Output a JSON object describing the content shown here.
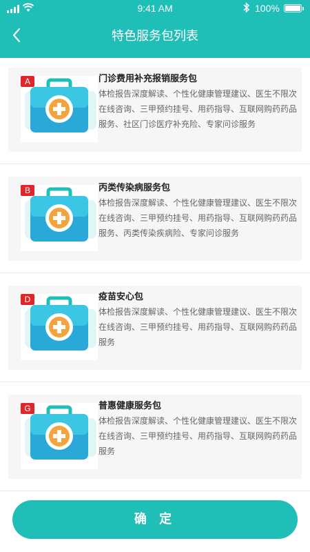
{
  "status_bar": {
    "time": "9:41 AM",
    "battery": "100%"
  },
  "header": {
    "title": "特色服务包列表",
    "back_icon": "chevron-left-icon"
  },
  "packages": [
    {
      "badge": "A",
      "title": "门诊费用补充报销服务包",
      "description": "体检报告深度解读、个性化健康管理建议、医生不限次在线咨询、三甲预约挂号、用药指导、互联网购药药品服务、社区门诊医疗补充险、专家问诊服务"
    },
    {
      "badge": "B",
      "title": "丙类传染病服务包",
      "description": "体检报告深度解读、个性化健康管理建议、医生不限次在线咨询、三甲预约挂号、用药指导、互联网购药药品服务、丙类传染疾病险、专家问诊服务"
    },
    {
      "badge": "D",
      "title": "疫苗安心包",
      "description": "体检报告深度解读、个性化健康管理建议、医生不限次在线咨询、三甲预约挂号、用药指导、互联网购药药品服务"
    },
    {
      "badge": "G",
      "title": "普惠健康服务包",
      "description": "体检报告深度解读、个性化健康管理建议、医生不限次在线咨询、三甲预约挂号、用药指导、互联网购药药品服务"
    }
  ],
  "confirm_button": "确 定",
  "colors": {
    "primary": "#1fbfb8",
    "badge": "#e0262b",
    "card_bg": "#f6f6f6",
    "orange": "#f5a33c"
  }
}
